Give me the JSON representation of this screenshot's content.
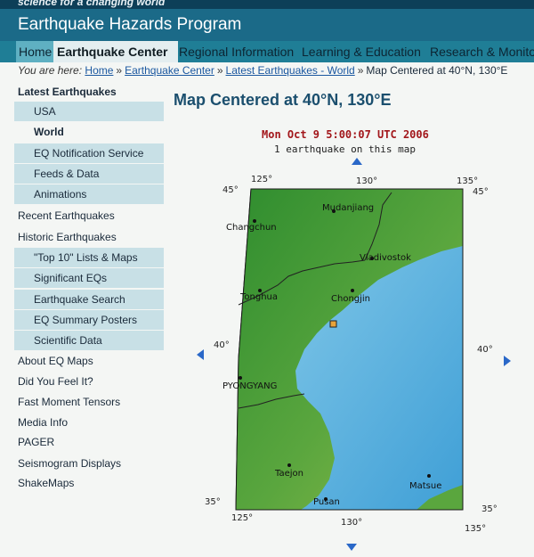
{
  "top_strip": "science for a changing world",
  "banner": {
    "title": "Earthquake Hazards Program"
  },
  "nav": {
    "home": "Home",
    "earthquake_center": "Earthquake Center",
    "regional": "Regional Information",
    "learning": "Learning & Education",
    "research": "Research & Monitoring"
  },
  "breadcrumb": {
    "you_are_here": "You are here:",
    "home": "Home",
    "earthquake_center": "Earthquake Center",
    "latest_world": "Latest Earthquakes - World",
    "current": "Map Centered at 40°N, 130°E"
  },
  "sidebar": {
    "latest": "Latest Earthquakes",
    "usa": "USA",
    "world": "World",
    "notification": "EQ Notification Service",
    "feeds": "Feeds & Data",
    "animations": "Animations",
    "recent": "Recent Earthquakes",
    "historic": "Historic Earthquakes",
    "top10": "\"Top 10\" Lists & Maps",
    "significant": "Significant EQs",
    "search": "Earthquake Search",
    "posters": "EQ Summary Posters",
    "scientific": "Scientific Data",
    "about": "About EQ Maps",
    "dyfi": "Did You Feel It?",
    "tensors": "Fast Moment Tensors",
    "media": "Media Info",
    "pager": "PAGER",
    "seismogram": "Seismogram Displays",
    "shakemaps": "ShakeMaps"
  },
  "main": {
    "title": "Map Centered at 40°N, 130°E",
    "date": "Mon Oct 9 5:00:07 UTC 2006",
    "count": "1 earthquake on this map"
  },
  "map": {
    "ticks": {
      "lon_left": "125°",
      "lon_mid": "130°",
      "lon_right": "135°",
      "lat_top": "45°",
      "lat_mid": "40°",
      "lat_bottom": "35°"
    },
    "cities": {
      "mudanjiang": "Mudanjiang",
      "changchun": "Changchun",
      "vladivostok": "Vladivostok",
      "tonghua": "Tonghua",
      "chongjin": "Chongjin",
      "pyongyang": "PYONGYANG",
      "taejon": "Taejon",
      "pusan": "Pusan",
      "matsue": "Matsue"
    },
    "colors": {
      "land": "#3f9a3a",
      "sea": "#5cb4e0",
      "earthquake": "#e8a33a"
    }
  }
}
